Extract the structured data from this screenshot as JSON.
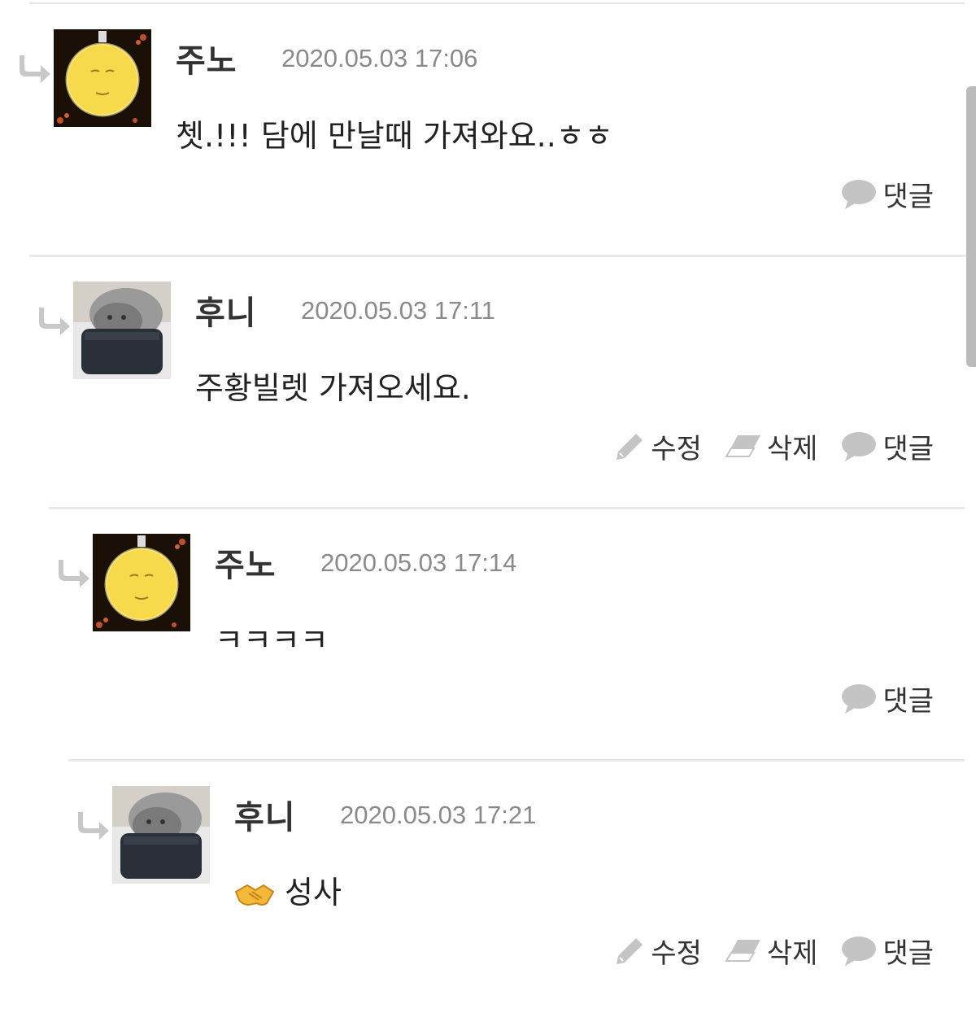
{
  "comments": [
    {
      "author": "주노",
      "date": "2020.05.03 17:06",
      "text": "쳇.!!! 담에 만날때 가져와요..ㅎㅎ",
      "avatar": "moon-avatar",
      "actions": {
        "reply": "댓글"
      }
    },
    {
      "author": "후니",
      "date": "2020.05.03 17:11",
      "text": "주황빌렛 가져오세요.",
      "avatar": "cat-avatar",
      "actions": {
        "edit": "수정",
        "delete": "삭제",
        "reply": "댓글"
      }
    },
    {
      "author": "주노",
      "date": "2020.05.03 17:14",
      "text": "ㅋㅋㅋㅋ",
      "avatar": "moon-avatar",
      "actions": {
        "reply": "댓글"
      }
    },
    {
      "author": "후니",
      "date": "2020.05.03 17:21",
      "text": "성사",
      "emoji": "handshake-icon",
      "avatar": "cat-avatar",
      "actions": {
        "edit": "수정",
        "delete": "삭제",
        "reply": "댓글"
      }
    }
  ],
  "colors": {
    "date": "#8a8a8a",
    "icon": "#bdbdbd",
    "divider": "#e9e9e9"
  }
}
